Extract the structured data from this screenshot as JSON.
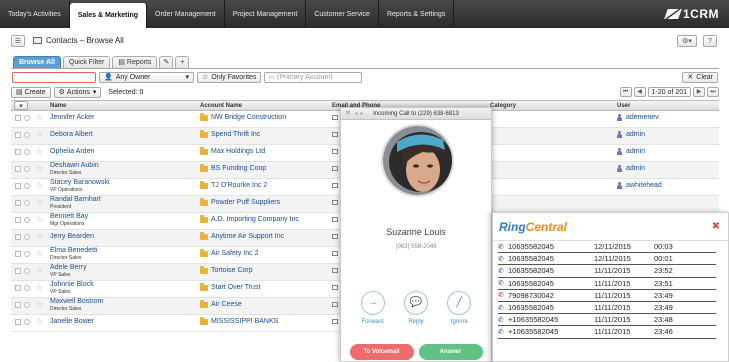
{
  "nav": {
    "tabs": [
      "Today's Activities",
      "Sales & Marketing",
      "Order Management",
      "Project Management",
      "Customer Service",
      "Reports & Settings"
    ],
    "active_index": 1,
    "logo_text": "1CRM"
  },
  "page": {
    "title": "Contacts – Browse All",
    "subtabs": [
      "Browse All",
      "Quick Filter",
      "Reports"
    ]
  },
  "filter": {
    "owner_label": "Any Owner",
    "favorites_label": "Only Favorites",
    "account_placeholder": "(Primary Account)",
    "clear_label": "Clear"
  },
  "actions": {
    "create_label": "Create",
    "actions_label": "Actions",
    "selected_label": "Selected: 0",
    "pager_text": "1-20 of 201"
  },
  "table": {
    "headers": {
      "name": "Name",
      "account": "Account Name",
      "email": "Email and Phone",
      "category": "Category",
      "user": "User"
    },
    "rows": [
      {
        "name": "Jennifer Acker",
        "title": "",
        "account": "NW Bridge Construction",
        "user": "ademenev"
      },
      {
        "name": "Debora Albert",
        "title": "",
        "account": "Spend Thrift Inc",
        "user": "admin"
      },
      {
        "name": "Ophelia Arden",
        "title": "",
        "account": "Max Holdings Ltd",
        "user": "admin"
      },
      {
        "name": "Deshawn Aubin",
        "title": "Director Sales",
        "account": "BS Funding Coop",
        "user": "admin"
      },
      {
        "name": "Stacey Baranowski",
        "title": "VP Operations",
        "account": "TJ O'Rourke Inc 2",
        "user": "awhitehead"
      },
      {
        "name": "Randal Barnhart",
        "title": "President",
        "account": "Powder Puff Suppliers",
        "user": ""
      },
      {
        "name": "Bennett Bay",
        "title": "Mgr Operations",
        "account": "A.D. Importing Company Inc",
        "user": ""
      },
      {
        "name": "Jerry Bearden",
        "title": "",
        "account": "Anytime Air Support Inc",
        "user": ""
      },
      {
        "name": "Elma Benedetti",
        "title": "Director Sales",
        "account": "Air Safety Inc 2",
        "user": ""
      },
      {
        "name": "Adele Berry",
        "title": "VP Sales",
        "account": "Tortoise Corp",
        "user": ""
      },
      {
        "name": "Johnnie Block",
        "title": "VP Sales",
        "account": "Start Over Trust",
        "user": ""
      },
      {
        "name": "Maxwell Bostrom",
        "title": "Director Sales",
        "account": "Air Ceese",
        "user": ""
      },
      {
        "name": "Janelle Bower",
        "title": "",
        "account": "MISSISSIPPI BANKS",
        "user": ""
      }
    ]
  },
  "call": {
    "header": "Incoming Call to (229) 638-6813",
    "caller_name": "Suzanne Louis",
    "caller_number": "(063) 558-2045",
    "forward_label": "Forward",
    "reply_label": "Reply",
    "ignore_label": "Ignore",
    "voicemail_label": "To Voicemail",
    "answer_label": "Answer",
    "colors": {
      "voicemail": "#ee6b6b",
      "answer": "#62c286",
      "accent": "#4a90c8"
    }
  },
  "ringcentral": {
    "logo_ring": "Ring",
    "logo_central": "Central",
    "logs": [
      {
        "number": "10635582045",
        "date": "12/11/2015",
        "time": "00:03",
        "missed": false
      },
      {
        "number": "10635582045",
        "date": "12/11/2015",
        "time": "00:01",
        "missed": false
      },
      {
        "number": "10635582045",
        "date": "11/11/2015",
        "time": "23:52",
        "missed": false
      },
      {
        "number": "10635582045",
        "date": "11/11/2015",
        "time": "23:51",
        "missed": false
      },
      {
        "number": "79098730042",
        "date": "11/11/2015",
        "time": "23:49",
        "missed": true
      },
      {
        "number": "10635582045",
        "date": "11/11/2015",
        "time": "23:49",
        "missed": false
      },
      {
        "number": "+10635582045",
        "date": "11/11/2015",
        "time": "23:48",
        "missed": false
      },
      {
        "number": "+10635582045",
        "date": "11/11/2015",
        "time": "23:46",
        "missed": false
      }
    ],
    "colors": {
      "ring": "#2f7cc4",
      "central": "#f28c1f"
    }
  }
}
